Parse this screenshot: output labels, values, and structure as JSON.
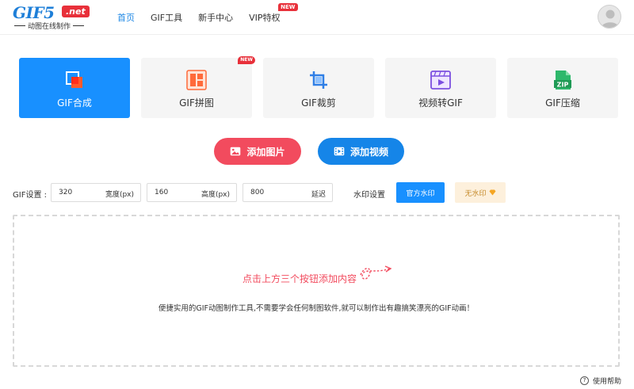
{
  "logo": {
    "main": "GIF5",
    "net": ".net",
    "subtitle": "动图在线制作"
  },
  "nav": {
    "items": [
      {
        "label": "首页",
        "active": true
      },
      {
        "label": "GIF工具",
        "active": false
      },
      {
        "label": "新手中心",
        "active": false
      },
      {
        "label": "VIP特权",
        "active": false,
        "badge": "NEW"
      }
    ]
  },
  "tools": [
    {
      "label": "GIF合成",
      "icon": "merge-icon",
      "active": true
    },
    {
      "label": "GIF拼图",
      "icon": "puzzle-icon",
      "active": false,
      "badge": "NEW"
    },
    {
      "label": "GIF裁剪",
      "icon": "crop-icon",
      "active": false
    },
    {
      "label": "视频转GIF",
      "icon": "video-convert-icon",
      "active": false
    },
    {
      "label": "GIF压缩",
      "icon": "zip-icon",
      "active": false,
      "icon_text": "ZIP"
    }
  ],
  "actions": {
    "add_image": "添加图片",
    "add_video": "添加视频"
  },
  "settings": {
    "label": "GIF设置 :",
    "width": {
      "value": "320",
      "unit": "宽度(px)"
    },
    "height": {
      "value": "160",
      "unit": "高度(px)"
    },
    "delay": {
      "value": "800",
      "unit": "延迟"
    },
    "watermark_label": "水印设置",
    "watermark_official": "官方水印",
    "watermark_none": "无水印"
  },
  "dropzone": {
    "hint": "点击上方三个按钮添加内容",
    "description": "便捷实用的GIF动图制作工具,不需要学会任何制图软件,就可以制作出有趣搞笑漂亮的GIF动画！"
  },
  "help": {
    "label": "使用帮助"
  },
  "colors": {
    "primary": "#1890ff",
    "accent_red": "#f24b5e",
    "video_blue": "#1585e8",
    "vip_bg": "#fdf0dc"
  }
}
